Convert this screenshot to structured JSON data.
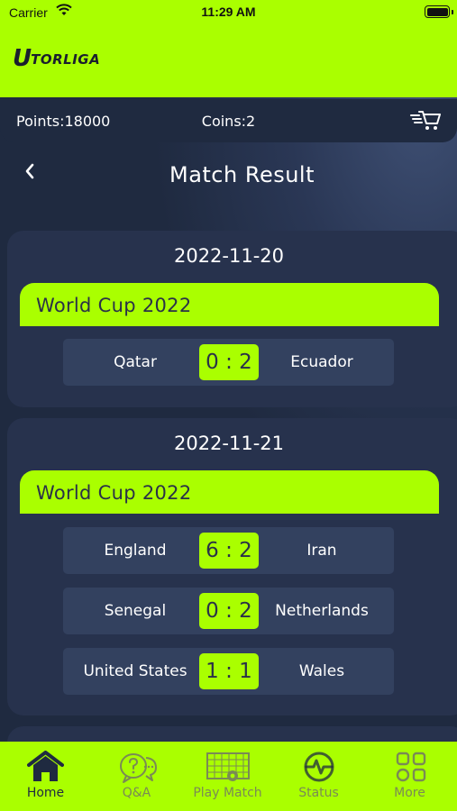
{
  "status_bar": {
    "carrier": "Carrier",
    "time": "11:29 AM"
  },
  "app": {
    "logo_mark": "U",
    "logo_text": "TORLIGA"
  },
  "accent_color": "#aaff00",
  "background_color": "#1f2a40",
  "summary": {
    "points": "Points:18000",
    "coins": "Coins:2"
  },
  "header": {
    "title": "Match Result"
  },
  "days": [
    {
      "date": "2022-11-20",
      "league": "World Cup 2022",
      "matches": [
        {
          "home": "Qatar",
          "score": "0 : 2",
          "away": "Ecuador"
        }
      ]
    },
    {
      "date": "2022-11-21",
      "league": "World Cup 2022",
      "matches": [
        {
          "home": "England",
          "score": "6 : 2",
          "away": "Iran"
        },
        {
          "home": "Senegal",
          "score": "0 : 2",
          "away": "Netherlands"
        },
        {
          "home": "United States",
          "score": "1 : 1",
          "away": "Wales"
        }
      ]
    }
  ],
  "tabs": [
    {
      "label": "Home",
      "icon": "home-icon",
      "active": true
    },
    {
      "label": "Q&A",
      "icon": "chat-question-icon",
      "active": false
    },
    {
      "label": "Play Match",
      "icon": "soccer-goal-icon",
      "active": false
    },
    {
      "label": "Status",
      "icon": "status-pulse-icon",
      "active": false
    },
    {
      "label": "More",
      "icon": "grid-icon",
      "active": false
    }
  ]
}
